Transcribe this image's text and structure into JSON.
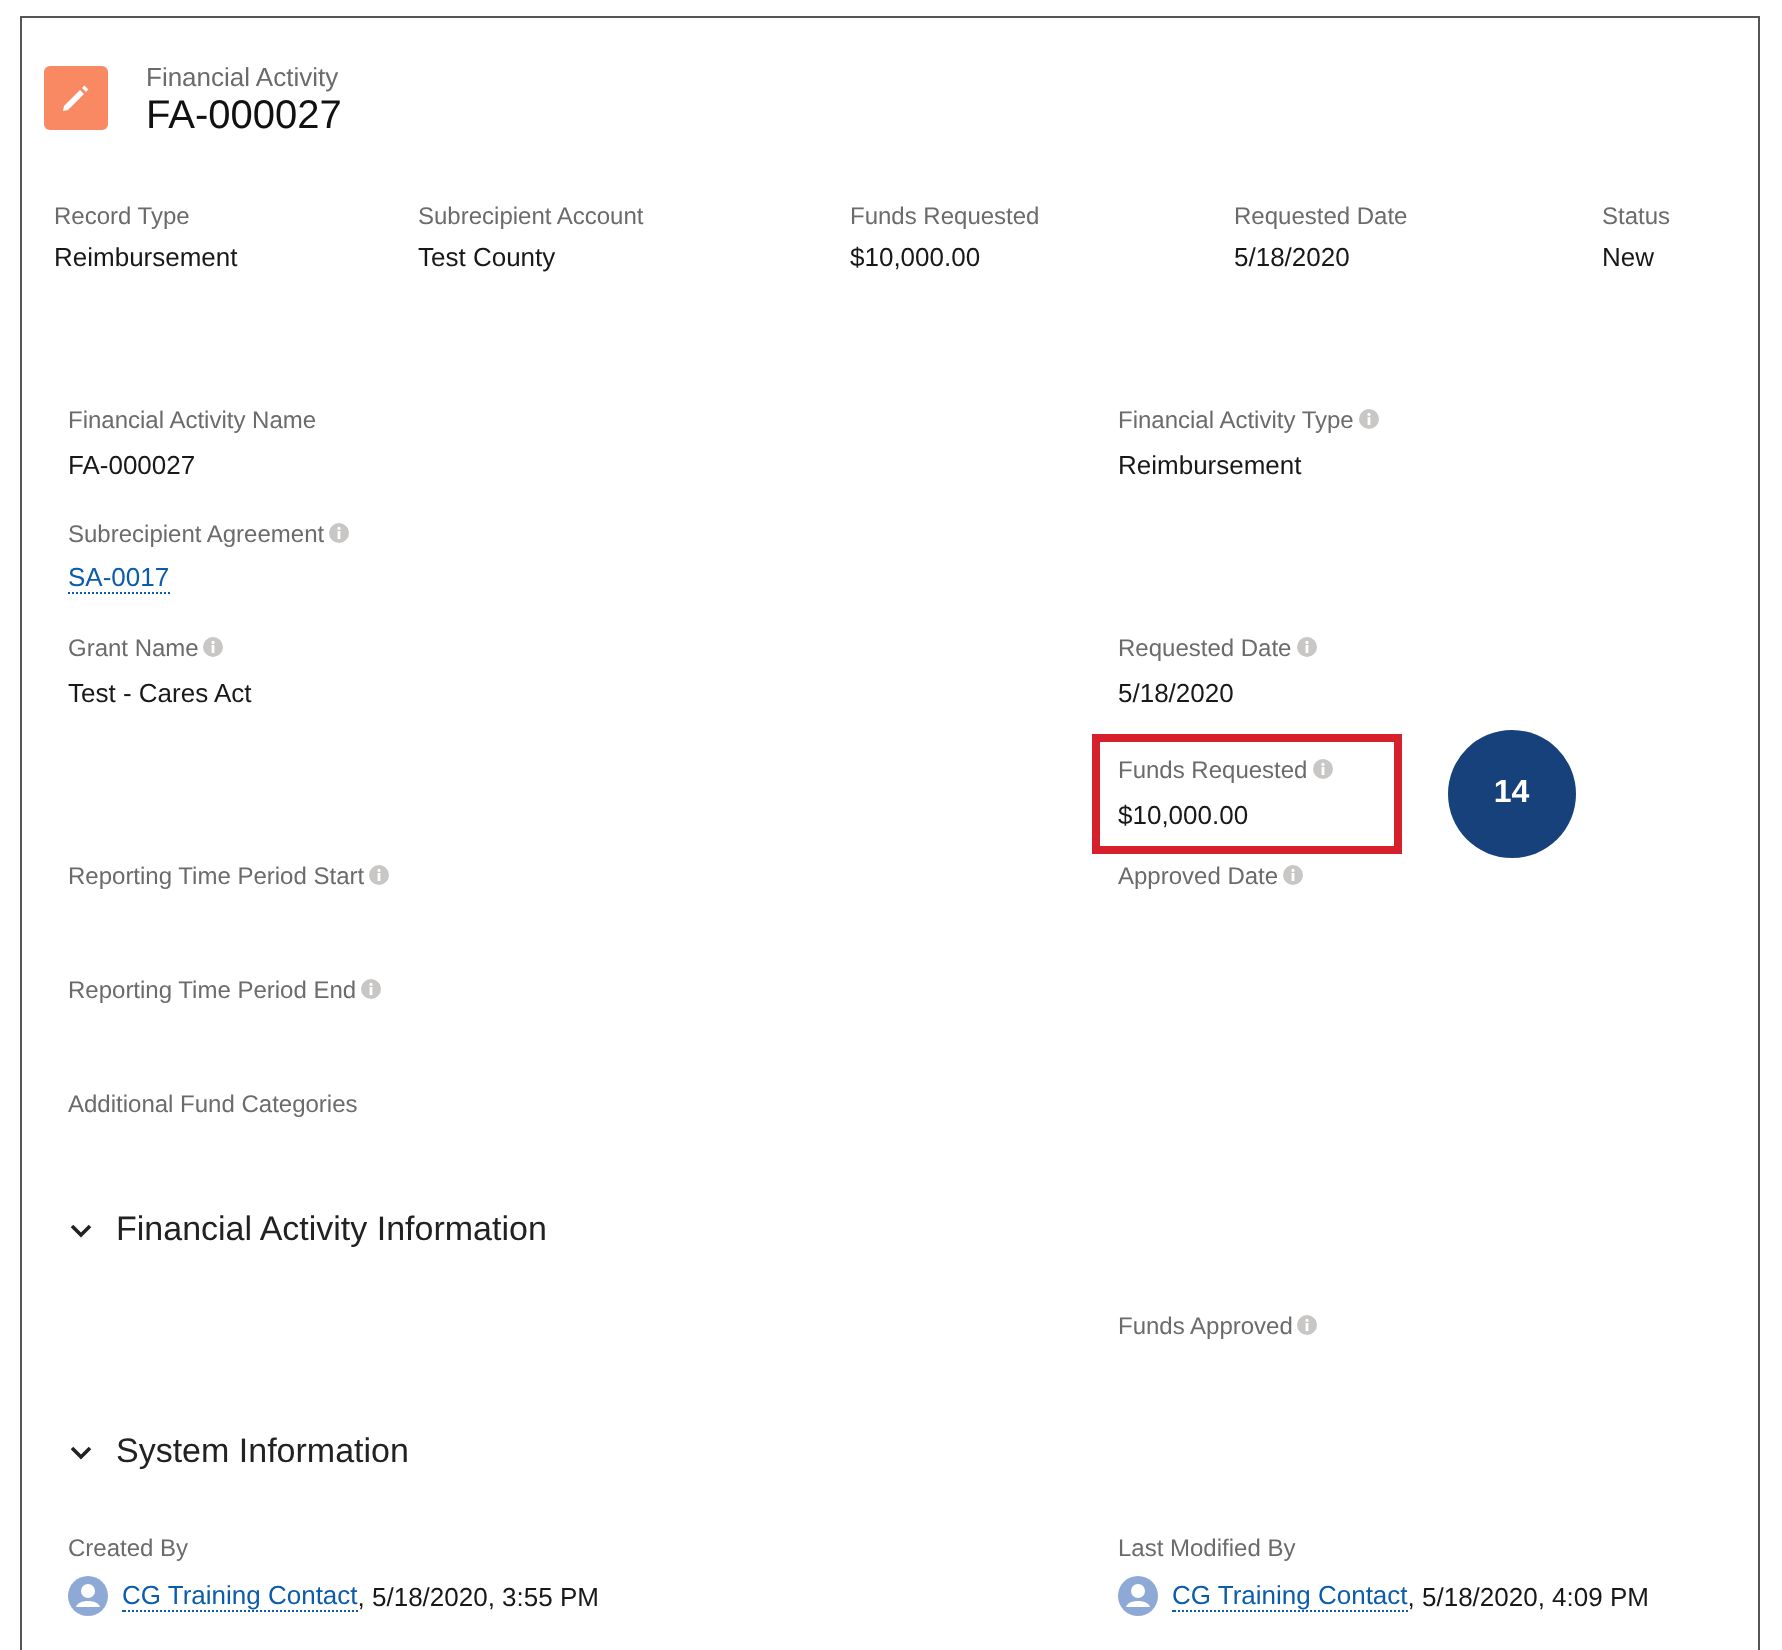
{
  "header": {
    "object_label": "Financial Activity",
    "title": "FA-000027"
  },
  "highlights": [
    {
      "label": "Record Type",
      "value": "Reimbursement"
    },
    {
      "label": "Subrecipient Account",
      "value": "Test County"
    },
    {
      "label": "Funds Requested",
      "value": "$10,000.00"
    },
    {
      "label": "Requested Date",
      "value": "5/18/2020"
    },
    {
      "label": "Status",
      "value": "New"
    }
  ],
  "rows": [
    {
      "left": {
        "label": "Financial Activity Name",
        "info": false,
        "kind": "text",
        "value": "FA-000027",
        "highlighted": false
      },
      "right": {
        "label": "Financial Activity Type",
        "info": true,
        "kind": "text",
        "value": "Reimbursement",
        "highlighted": false
      }
    },
    {
      "left": {
        "label": "Subrecipient Agreement",
        "info": true,
        "kind": "link",
        "value": "SA-0017",
        "highlighted": false
      },
      "right": null
    },
    {
      "left": {
        "label": "Grant Name",
        "info": true,
        "kind": "text",
        "value": "Test - Cares Act",
        "highlighted": false
      },
      "right": {
        "label": "Requested Date",
        "info": true,
        "kind": "text",
        "value": "5/18/2020",
        "highlighted": false
      }
    },
    {
      "left": null,
      "right": {
        "label": "Funds Requested",
        "info": true,
        "kind": "text",
        "value": "$10,000.00",
        "highlighted": true,
        "callout": "14"
      }
    },
    {
      "left": {
        "label": "Reporting Time Period Start",
        "info": true,
        "highlighted": false
      },
      "right": {
        "label": "Approved Date",
        "info": true,
        "highlighted": false
      }
    },
    {
      "left": {
        "label": "Reporting Time Period End",
        "info": true,
        "highlighted": false
      },
      "right": null
    },
    {
      "left": {
        "label": "Additional Fund Categories",
        "info": false,
        "highlighted": false
      },
      "right": null
    }
  ],
  "sections": [
    {
      "title": "Financial Activity Information",
      "expanded": true,
      "rows": [
        {
          "left": null,
          "right": {
            "label": "Funds Approved",
            "info": true,
            "highlighted": false
          }
        }
      ]
    },
    {
      "title": "System Information",
      "expanded": true,
      "rows": [
        {
          "left": {
            "label": "Created By",
            "info": false,
            "kind": "user",
            "value": "CG Training Contact",
            "suffix": ", 5/18/2020, 3:55 PM",
            "highlighted": false
          },
          "right": {
            "label": "Last Modified By",
            "info": false,
            "kind": "user",
            "value": "CG Training Contact",
            "suffix": ", 5/18/2020, 4:09 PM",
            "highlighted": false
          }
        }
      ]
    }
  ]
}
